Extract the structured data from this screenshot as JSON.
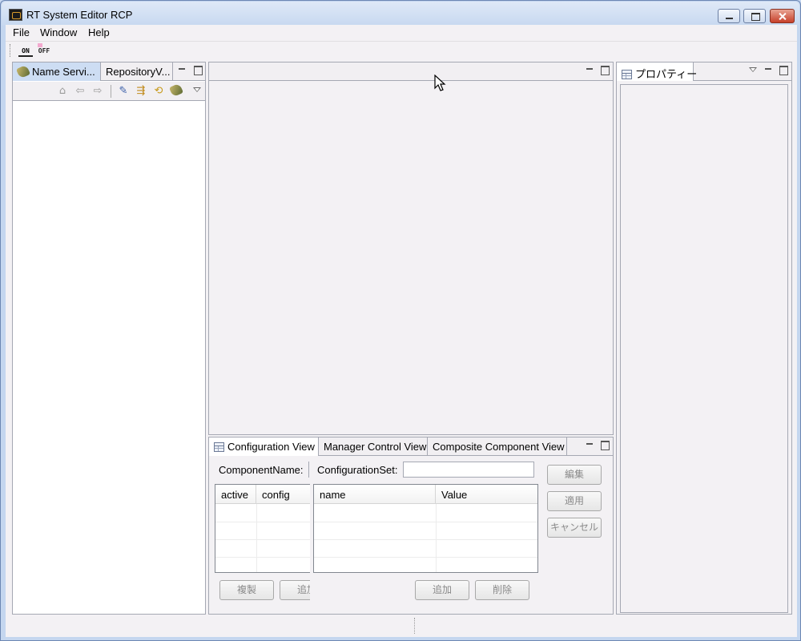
{
  "window": {
    "title": "RT System Editor RCP"
  },
  "menu": [
    "File",
    "Window",
    "Help"
  ],
  "toolbar": {
    "on_label": "ON",
    "off_label": "OFF"
  },
  "left_panel": {
    "tabs": [
      "Name Servi...",
      "RepositoryV..."
    ]
  },
  "right_panel": {
    "tabs": [
      "プロパティー"
    ]
  },
  "bottom_panel": {
    "tabs": [
      "Configuration View",
      "Manager Control View",
      "Composite Component View"
    ],
    "component_name_label": "ComponentName:",
    "configuration_set_label": "ConfigurationSet:",
    "left_table_headers": [
      "active",
      "config"
    ],
    "right_table_headers": [
      "name",
      "Value"
    ],
    "buttons": {
      "edit": "編集",
      "apply": "適用",
      "cancel": "キャンセル",
      "copy": "複製",
      "add_left": "追加",
      "add": "追加",
      "delete": "削除"
    }
  },
  "colors": {
    "title_gradient_top": "#dfe9f7",
    "title_gradient_bottom": "#c7d8f0",
    "workspace_bg": "#f3f1f4",
    "close_button": "#c7402a"
  }
}
